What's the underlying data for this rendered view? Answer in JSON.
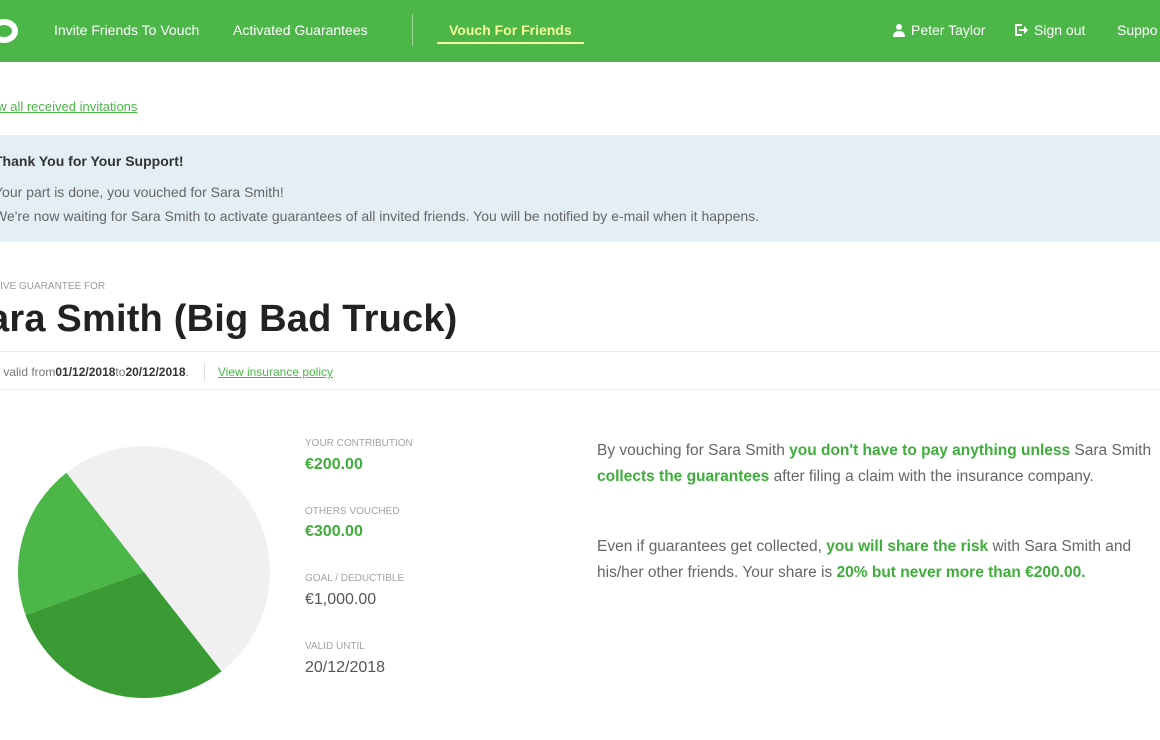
{
  "nav": {
    "invite": "Invite Friends To Vouch",
    "activated": "Activated Guarantees",
    "vouch": "Vouch For Friends",
    "user": "Peter Taylor",
    "signout": "Sign out",
    "support": "Suppo"
  },
  "back_link": "ow all received invitations",
  "alert": {
    "title": "Thank You for Your Support!",
    "line1": "Your part is done, you vouched for Sara Smith!",
    "line2": "We're now waiting for Sara Smith to activate guarantees of all invited friends. You will be notified by e-mail when it happens."
  },
  "header": {
    "eyebrow": "TIVE GUARANTEE FOR",
    "title": "ara Smith (Big Bad Truck)"
  },
  "policy": {
    "prefix": "cy valid from ",
    "from": "01/12/2018",
    "mid": " to ",
    "to": "20/12/2018",
    "suffix": ".",
    "link": "View insurance policy"
  },
  "stats": {
    "contribution_label": "YOUR CONTRIBUTION",
    "contribution_value": "€200.00",
    "others_label": "OTHERS VOUCHED",
    "others_value": "€300.00",
    "goal_label": "GOAL / DEDUCTIBLE",
    "goal_value": "€1,000.00",
    "valid_label": "VALID UNTIL",
    "valid_value": "20/12/2018"
  },
  "pie_chart": {
    "total": 1000,
    "slices": [
      {
        "name": "contribution",
        "value": 200,
        "color": "#4cb748"
      },
      {
        "name": "others_vouched",
        "value": 300,
        "color": "#3a9a34"
      },
      {
        "name": "remaining",
        "value": 500,
        "color": "#f0f0f0"
      }
    ]
  },
  "description": {
    "p1": [
      {
        "text": "By vouching for Sara Smith ",
        "bold": false
      },
      {
        "text": "you don't have to pay anything unless",
        "bold": true
      },
      {
        "text": " Sara Smith ",
        "bold": false
      },
      {
        "text": "collects the guarantees",
        "bold": true
      },
      {
        "text": " after filing a claim with the insurance company.",
        "bold": false
      }
    ],
    "p2": [
      {
        "text": "Even if guarantees get collected, ",
        "bold": false
      },
      {
        "text": "you will share the risk",
        "bold": true
      },
      {
        "text": " with Sara Smith and his/her other friends. Your share is ",
        "bold": false
      },
      {
        "text": "20% but never more than €200.00.",
        "bold": true
      }
    ]
  },
  "colors": {
    "brand_green": "#4cb748",
    "dark_green": "#3a9a34",
    "active_nav": "#f3ff9a",
    "alert_bg": "#e3eff5"
  }
}
